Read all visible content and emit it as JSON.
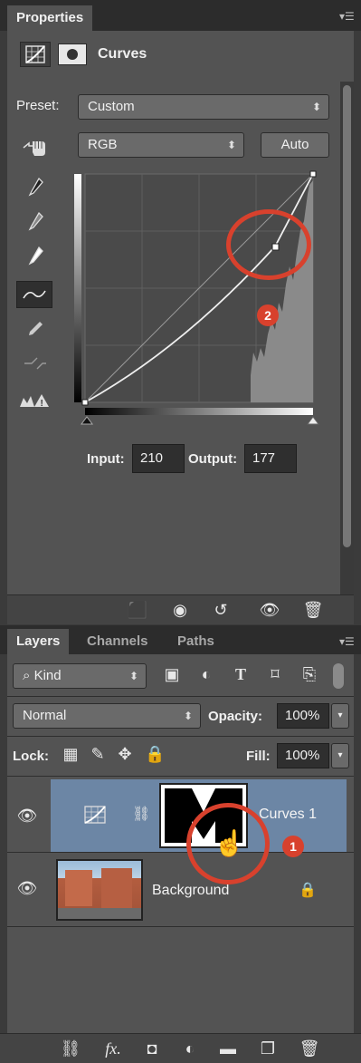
{
  "properties": {
    "tab_label": "Properties",
    "adjustment_title": "Curves",
    "preset_label": "Preset:",
    "preset_value": "Custom",
    "channel_value": "RGB",
    "auto_label": "Auto",
    "input_label": "Input:",
    "input_value": "210",
    "output_label": "Output:",
    "output_value": "177",
    "footer_icons": [
      "clip-to-layer-icon",
      "view-previous-icon",
      "reset-icon",
      "visibility-icon",
      "trash-icon"
    ]
  },
  "layers": {
    "tabs": [
      "Layers",
      "Channels",
      "Paths"
    ],
    "filter_kind": "Kind",
    "blend_mode": "Normal",
    "opacity_label": "Opacity:",
    "opacity_value": "100%",
    "lock_label": "Lock:",
    "fill_label": "Fill:",
    "fill_value": "100%",
    "items": [
      {
        "name": "Curves 1",
        "selected": true
      },
      {
        "name": "Background",
        "selected": false,
        "locked": true
      }
    ],
    "footer_icons": [
      "link-icon",
      "fx-icon",
      "mask-icon",
      "adjustment-icon",
      "folder-icon",
      "new-layer-icon",
      "trash-icon"
    ]
  },
  "annotations": {
    "badge_1": "1",
    "badge_2": "2",
    "color": "#d8412d"
  },
  "colors": {
    "panel_bg": "#535353",
    "dark_bg": "#3b3b3b",
    "selected_layer": "#6c86a5"
  }
}
